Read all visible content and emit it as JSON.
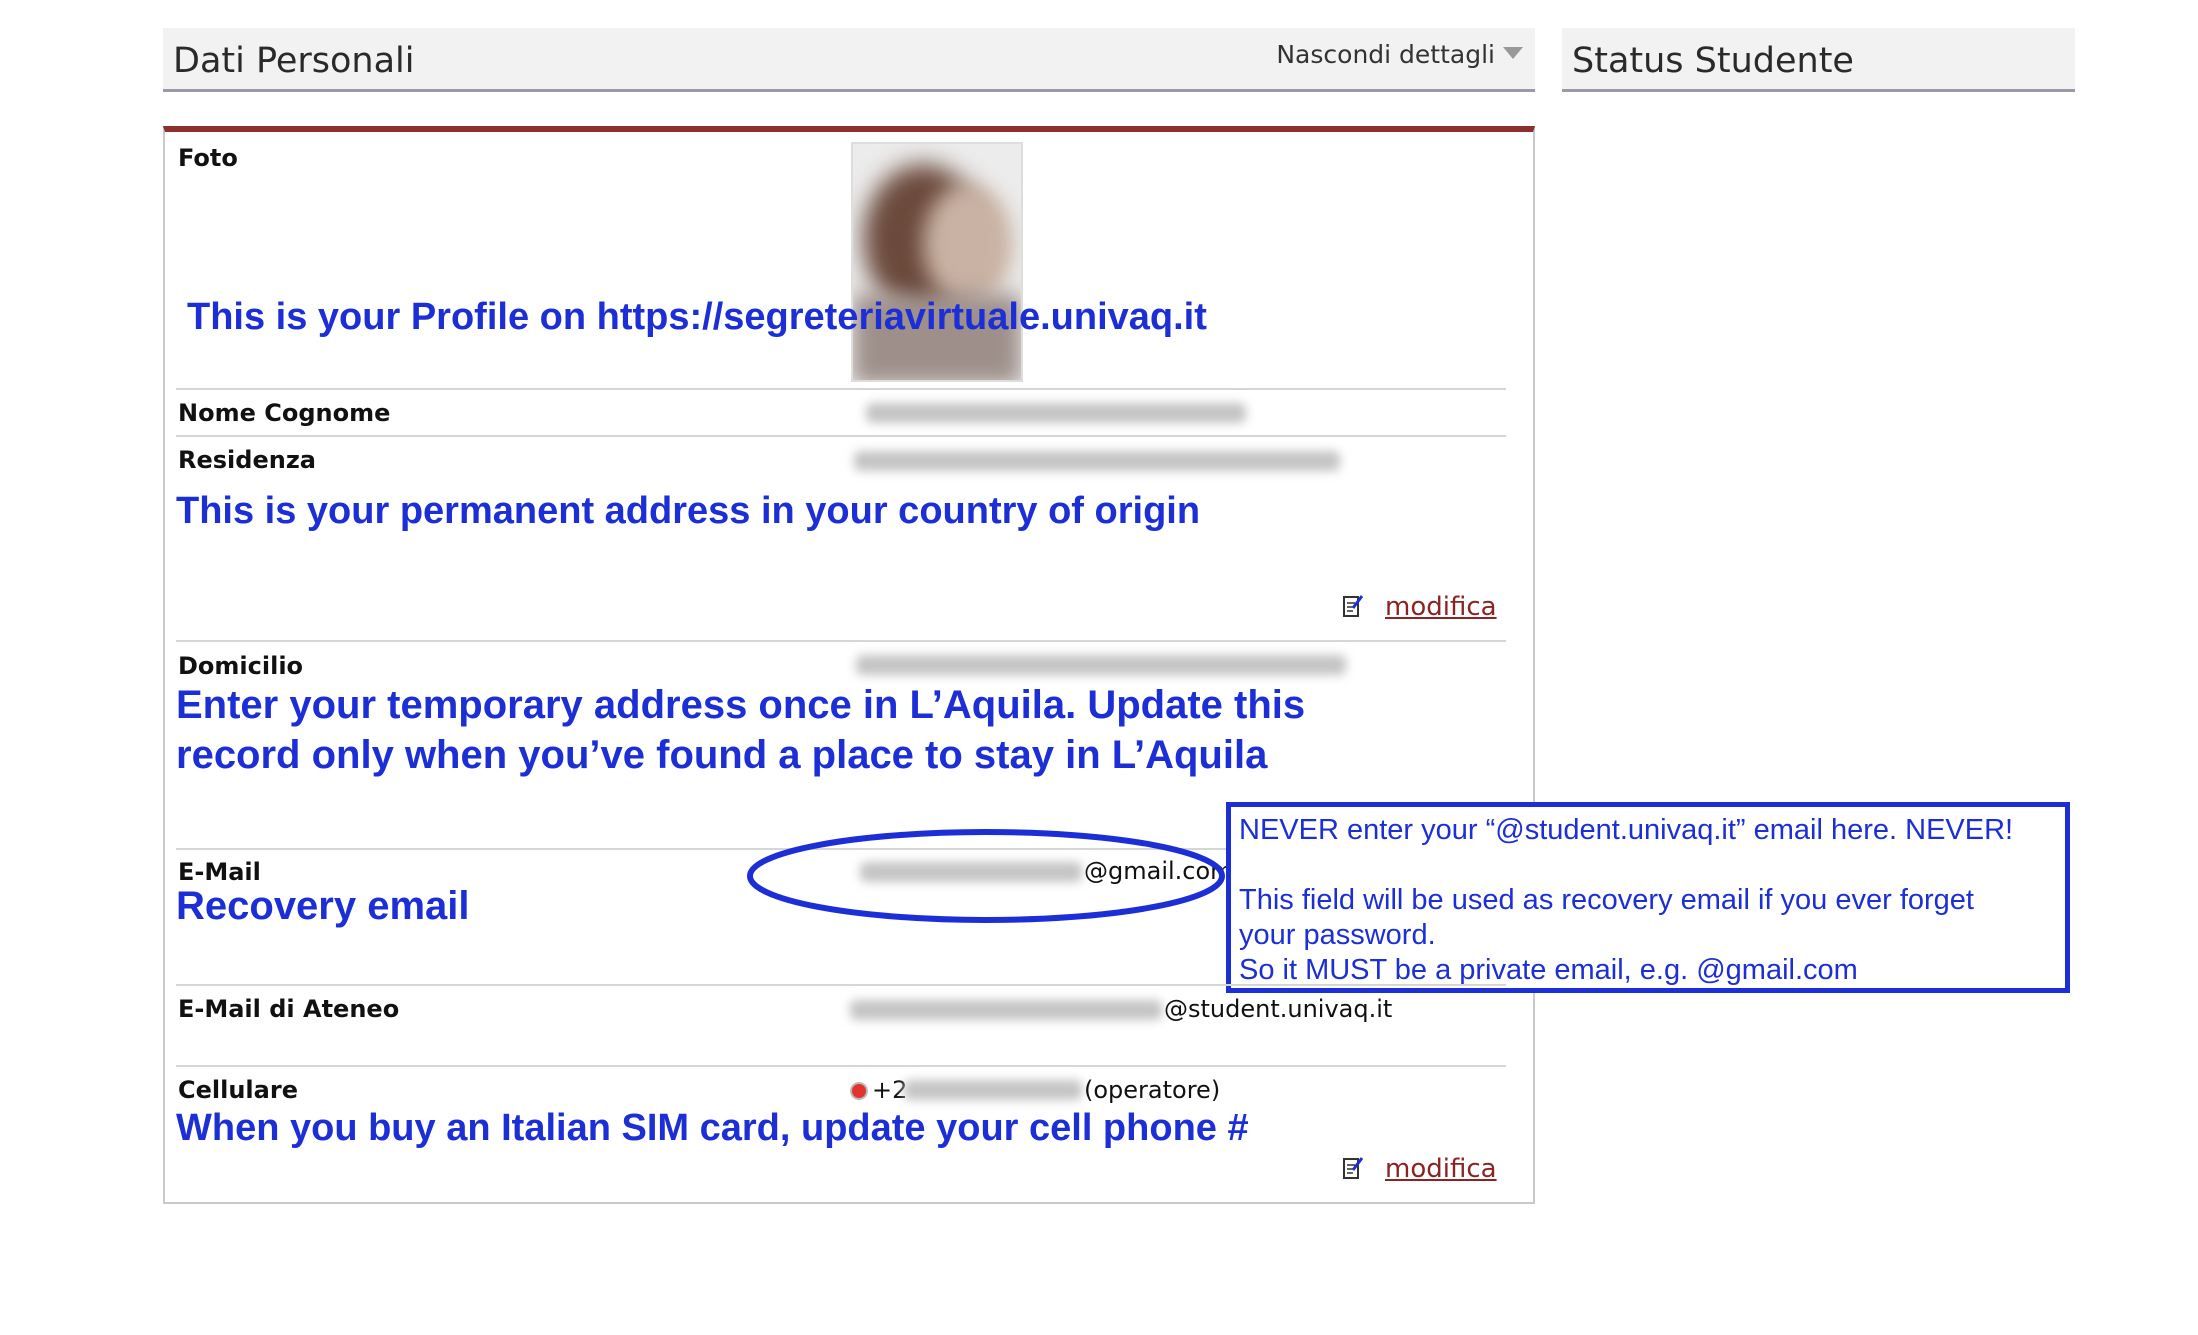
{
  "header": {
    "personal_title": "Dati Personali",
    "toggle_label": "Nascondi dettagli",
    "status_title": "Status Studente"
  },
  "fields": {
    "photo_label": "Foto",
    "name_label": "Nome Cognome",
    "residence_label": "Residenza",
    "domicile_label": "Domicilio",
    "email_label": "E-Mail",
    "email_suffix": "@gmail.com",
    "university_email_label": "E-Mail di Ateneo",
    "university_email_suffix": "@student.univaq.it",
    "mobile_label": "Cellulare",
    "mobile_prefix": "+2",
    "mobile_suffix": "(operatore)",
    "edit_label": "modifica"
  },
  "annotations": {
    "profile": "This is your Profile on https://segreteriavirtuale.univaq.it",
    "residence": "This is your permanent address in your country of origin",
    "domicile_line1": "Enter your temporary address once in L’Aquila. Update this",
    "domicile_line2": "record only when you’ve found a place to stay in L’Aquila",
    "recovery": "Recovery email",
    "sim": "When you buy an Italian SIM card, update your cell phone #",
    "callout_line1": "NEVER enter your “@student.univaq.it” email here. NEVER!",
    "callout_line2": "This field will be used as recovery email if you ever forget",
    "callout_line3": "your password.",
    "callout_line4": "So it MUST be a private email, e.g. @gmail.com"
  },
  "colors": {
    "annotation_blue": "#1c2fd6",
    "panel_accent": "#8b2f2f",
    "link": "#8b2323"
  },
  "icons": {
    "edit": "edit-note-icon",
    "toggle": "caret-down-icon",
    "phone_flag": "red-flag-icon"
  }
}
